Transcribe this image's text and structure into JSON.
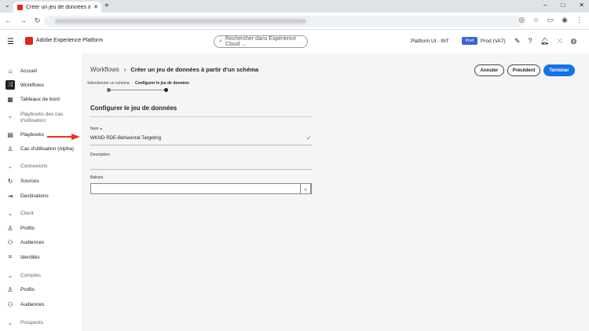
{
  "browser": {
    "tab_title": "Créer un jeu de données à partir",
    "new_tab": "+",
    "tabs_menu": "⌄",
    "window_controls": [
      "–",
      "□",
      "✕"
    ]
  },
  "header": {
    "brand": "Adobe Experience Platform",
    "search_placeholder": "Rechercher dans Experience Cloud ...",
    "org": "Platform UI - INT",
    "prod_badge": "Prod",
    "sandbox": "Prod (VA7)"
  },
  "sidebar": {
    "items": [
      {
        "label": "Accueil",
        "icon": "home-icon"
      },
      {
        "label": "Workflows",
        "icon": "workflows-icon",
        "active": true
      },
      {
        "label": "Tableaux de bord",
        "icon": "dashboard-icon"
      },
      {
        "label": "Playbooks des cas d'utilisation",
        "section": true
      },
      {
        "label": "Playbooks",
        "icon": "playbooks-icon"
      },
      {
        "label": "Cas d'utilisation (Alpha)",
        "icon": "usecase-icon"
      },
      {
        "label": "Connexions",
        "section": true
      },
      {
        "label": "Sources",
        "icon": "sources-icon"
      },
      {
        "label": "Destinations",
        "icon": "destinations-icon"
      },
      {
        "label": "Client",
        "section": true
      },
      {
        "label": "Profils",
        "icon": "profiles-icon"
      },
      {
        "label": "Audiences",
        "icon": "audiences-icon"
      },
      {
        "label": "Identités",
        "icon": "identities-icon"
      },
      {
        "label": "Comptes",
        "section": true
      },
      {
        "label": "Profils",
        "icon": "profiles-icon"
      },
      {
        "label": "Audiences",
        "icon": "audiences-icon"
      },
      {
        "label": "Prospects",
        "section": true
      }
    ]
  },
  "main": {
    "breadcrumb_root": "Workflows",
    "breadcrumb_sep": "›",
    "page_title": "Créer un jeu de données à partir d'un schéma",
    "buttons": {
      "cancel": "Annuler",
      "previous": "Précédent",
      "finish": "Terminer"
    },
    "steps": [
      "Sélectionner un schéma",
      "Configurer le jeu de données"
    ],
    "section_title": "Configurer le jeu de données",
    "name_label": "Nom",
    "name_required": "●",
    "name_value": "WKND-RDE-Behavioral-Targeting",
    "description_label": "Description",
    "description_value": "",
    "tags_label": "Balises",
    "tags_value": ""
  }
}
